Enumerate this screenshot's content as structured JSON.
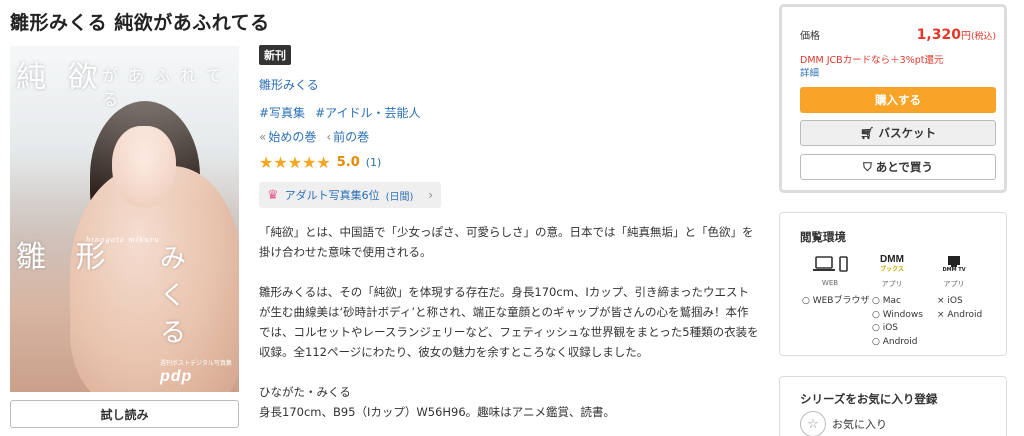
{
  "product": {
    "title": "雛形みくる 純欲があふれてる",
    "badge": "新刊",
    "author": "雛形みくる",
    "tags": [
      "#写真集",
      "#アイドル・芸能人"
    ],
    "nav": {
      "first": "始めの巻",
      "prev": "前の巻"
    },
    "rating": {
      "stars": 5,
      "score": "5.0",
      "count": "(1)"
    },
    "rank": {
      "label": "アダルト写真集6位",
      "period": "(日間)"
    },
    "sample_button": "試し読み"
  },
  "cover": {
    "title_top_big": "純 欲",
    "title_top_small": "があふれてる",
    "name_big_left": "雛 形",
    "name_big_right": "み く る",
    "name_romaji": "hinagata mikuru",
    "logo_sub": "週刊ポストデジタル写真集",
    "logo": "pdp"
  },
  "description": {
    "p1": "「純欲」とは、中国語で「少女っぽさ、可愛らしさ」の意。日本では「純真無垢」と「色欲」を掛け合わせた意味で使用される。",
    "p2": "雛形みくるは、その「純欲」を体現する存在だ。身長170cm、Iカップ、引き締まったウエストが生む曲線美は‘砂時計ボディ’と称され、端正な童顔とのギャップが皆さんの心を鷲掴み！本作では、コルセットやレースランジェリーなど、フェティッシュな世界観をまとった5種類の衣装を収録。全112ページにわたり、彼女の魅力を余すところなく収録しました。",
    "p3_name": "ひながた・みくる",
    "p3_body": "身長170cm、B95（Iカップ）W56H96。趣味はアニメ鑑賞、読書。"
  },
  "purchase": {
    "price_label": "価格",
    "price": "1,320",
    "yen": "円",
    "tax": "(税込)",
    "promo": "DMM JCBカードなら＋3%pt還元",
    "detail": "詳細",
    "buy": "購入する",
    "basket": "バスケット",
    "later": "あとで買う"
  },
  "environment": {
    "title": "閲覧環境",
    "web_label": "WEB",
    "app_label": "アプリ",
    "app2_label": "アプリ",
    "dmm_books_logo": "DMM",
    "dmm_books_sub": "ブックス",
    "dmm_tv_logo": "DMM TV",
    "web": [
      "○ WEBブラウザ"
    ],
    "books": [
      "○ Mac",
      "○ Windows",
      "○ iOS",
      "○ Android"
    ],
    "tv": [
      "× iOS",
      "× Android"
    ]
  },
  "series": {
    "title": "シリーズをお気に入り登録",
    "fav_label": "お気に入り"
  },
  "colors": {
    "link": "#2b6fb5",
    "price": "#e2372b",
    "buy_button": "#f7a428",
    "star": "#f5a623"
  }
}
